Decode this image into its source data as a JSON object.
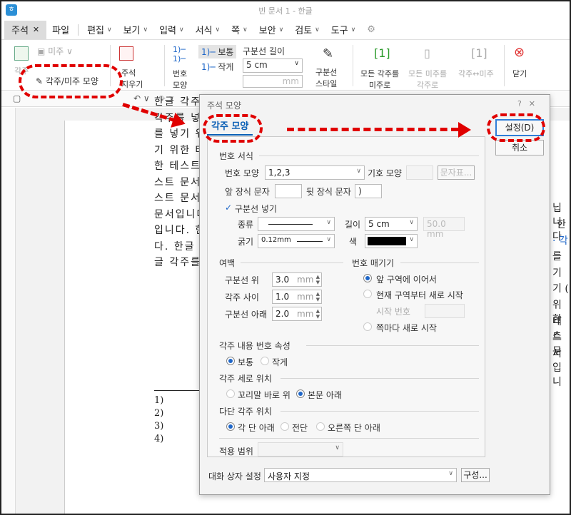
{
  "window": {
    "title": "빈 문서 1 - 한글",
    "app_icon": "hwp-app-icon"
  },
  "menubar": {
    "active_tab": "주석",
    "active_tab_close": "✕",
    "file": "파일",
    "items": [
      {
        "label": "편집"
      },
      {
        "label": "보기"
      },
      {
        "label": "입력"
      },
      {
        "label": "서식"
      },
      {
        "label": "쪽"
      },
      {
        "label": "보안"
      },
      {
        "label": "검토"
      },
      {
        "label": "도구"
      }
    ]
  },
  "ribbon": {
    "endnote_label": "미주",
    "footnote_label": "각주",
    "footnote_shape": "각주/미주 모양",
    "annot_label": "주석",
    "annot_label2": "지우기",
    "num_shape_label": "번호",
    "num_shape_label2": "모양",
    "normal_label": "보통",
    "small_label": "작게",
    "sep_length_label": "구분선 길이",
    "sep_length_value": "5 cm",
    "sep_length_unit": "mm",
    "sep_style_label": "구분선",
    "sep_style_label2": "스타일",
    "all_footnotes_label": "모든 각주를",
    "all_footnotes_label2": "미주로",
    "all_endnotes_label": "모든 미주를",
    "all_endnotes_label2": "각주로",
    "swap_label": "각주↔미주",
    "close_label": "닫기"
  },
  "document": {
    "lines": [
      "한글 각주",
      "각주를 넣",
      "를 넣기 위",
      "기 위한 테",
      "한 테스트",
      "스트 문서",
      "스트 문서",
      "문서입니다",
      "입니다. 한",
      "다. 한글 ",
      "글 각주를"
    ],
    "right_fragments": [
      {
        "text": "닙니다"
      },
      {
        "text": "한"
      },
      {
        "text": "· 각"
      },
      {
        "text": "를 "
      },
      {
        "text": "기 "
      },
      {
        "text": "기 ("
      },
      {
        "text": "위한"
      },
      {
        "text": "테스"
      },
      {
        "text": "트 문"
      },
      {
        "text": "서입니"
      }
    ],
    "footnotes": [
      "1)",
      "2)",
      "3)",
      "4)"
    ]
  },
  "dialog": {
    "title": "주석 모양",
    "tab": "각주 모양",
    "ok": "설정(D)",
    "cancel": "취소",
    "number_format": {
      "title": "번호 서식",
      "shape_label": "번호 모양",
      "shape_value": "1,2,3",
      "symbol_label": "기호 모양",
      "char_button": "문자표...",
      "prefix_label": "앞 장식 문자",
      "prefix_value": "",
      "suffix_label": "뒷 장식 문자",
      "suffix_value": ")"
    },
    "separator": {
      "check_label": "구분선 넣기",
      "type_label": "종류",
      "length_label": "길이",
      "length_value": "5 cm",
      "length_custom": "50.0",
      "length_unit": "mm",
      "thickness_label": "굵기",
      "thickness_value": "0.12mm",
      "color_label": "색",
      "color_value": "#000000"
    },
    "margin": {
      "title": "여백",
      "above_label": "구분선 위",
      "above_value": "3.0",
      "between_label": "각주 사이",
      "between_value": "1.0",
      "below_label": "구분선 아래",
      "below_value": "2.0",
      "unit": "mm"
    },
    "numbering": {
      "title": "번호 매기기",
      "continue": "앞 구역에 이어서",
      "restart": "현재 구역부터 새로 시작",
      "start_label": "시작 번호",
      "per_page": "쪽마다 새로 시작"
    },
    "content_num": {
      "title": "각주 내용 번호 속성",
      "normal": "보통",
      "small": "작게"
    },
    "vertical_pos": {
      "title": "각주 세로 위치",
      "tail": "꼬리말 바로 위",
      "below": "본문 아래"
    },
    "column_pos": {
      "title": "다단 각주 위치",
      "each": "각 단 아래",
      "full": "전단",
      "right": "오른쪽 단 아래"
    },
    "scope_label": "적용 범위",
    "dialog_setting_label": "대화 상자 설정",
    "dialog_setting_value": "사용자 지정",
    "configure_button": "구성..."
  }
}
